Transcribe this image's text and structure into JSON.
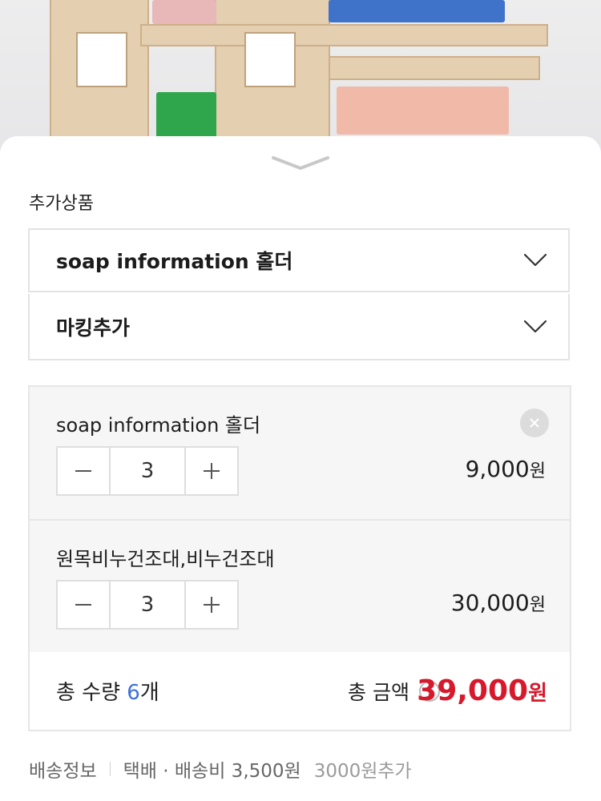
{
  "colors": {
    "accent_red": "#d7192c",
    "accent_blue": "#3d6fd6",
    "border": "#e3e3e3"
  },
  "photo": {
    "alt": "wooden soap rack product photo"
  },
  "sheet": {
    "handle_icon": "chevron-down-icon",
    "section_title": "추가상품",
    "selects": [
      {
        "label": "soap information 홀더",
        "icon": "chevron-down-icon"
      },
      {
        "label": "마킹추가",
        "icon": "chevron-down-icon"
      }
    ],
    "items": [
      {
        "name": "soap information 홀더",
        "qty": "3",
        "price": "9,000",
        "unit": "원"
      },
      {
        "name": "원목비누건조대,비누건조대",
        "qty": "3",
        "price": "30,000",
        "unit": "원"
      }
    ],
    "totals": {
      "qty_label": "총 수량 ",
      "qty_count": "6",
      "qty_unit": "개",
      "amount_label": "총 금액",
      "help": "?",
      "total_price": "39,000",
      "unit": "원"
    },
    "shipping": {
      "label": "배송정보",
      "method": "택배 · 배송비 3,500원",
      "extra": "3000원추가"
    }
  }
}
